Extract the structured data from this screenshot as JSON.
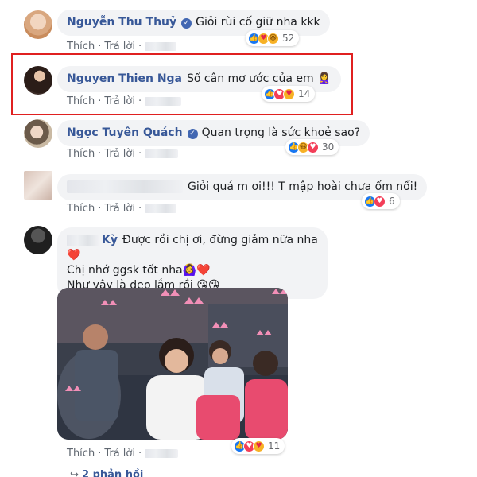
{
  "comments": [
    {
      "author": "Nguyễn Thu Thuỷ",
      "verified": true,
      "text": "Giỏi rùi cố giữ nha kkk",
      "actions": {
        "like": "Thích",
        "reply": "Trả lời"
      },
      "reactions": {
        "types": [
          "like",
          "care",
          "haha"
        ],
        "count": "52"
      }
    },
    {
      "author": "Nguyen Thien Nga",
      "verified": false,
      "text": "Số cân mơ ước của em 🙎‍♀️",
      "actions": {
        "like": "Thích",
        "reply": "Trả lời"
      },
      "reactions": {
        "types": [
          "like",
          "love",
          "care"
        ],
        "count": "14"
      }
    },
    {
      "author": "Ngọc Tuyên Quách",
      "verified": true,
      "text": "Quan trọng là sức khoẻ sao?",
      "actions": {
        "like": "Thích",
        "reply": "Trả lời"
      },
      "reactions": {
        "types": [
          "like",
          "haha",
          "love"
        ],
        "count": "30"
      }
    },
    {
      "author": "",
      "verified": false,
      "text": "Giỏi quá m ơi!!! T mập hoài chưa ốm nổi!",
      "actions": {
        "like": "Thích",
        "reply": "Trả lời"
      },
      "reactions": {
        "types": [
          "like",
          "love"
        ],
        "count": "6"
      }
    },
    {
      "author": "Kỳ",
      "verified": false,
      "lines": [
        "Được rồi chị ơi, đừng giảm nữa nha❤️",
        "Chị nhớ ggsk tốt nha🙆‍♀️❤️",
        "Như vậy là đẹp lắm rồi 😘😘"
      ],
      "actions": {
        "like": "Thích",
        "reply": "Trả lời"
      },
      "reactions": {
        "types": [
          "like",
          "love",
          "care"
        ],
        "count": "11"
      }
    }
  ],
  "replies_link": "2 phản hồi",
  "colors": {
    "accent": "#385898",
    "highlight": "#e02020",
    "bubble": "#f2f3f5"
  },
  "icons": {
    "like": "thumbs-up-icon",
    "love": "heart-icon",
    "haha": "laughing-face-icon",
    "care": "care-hug-icon",
    "verified": "verified-check-icon"
  }
}
